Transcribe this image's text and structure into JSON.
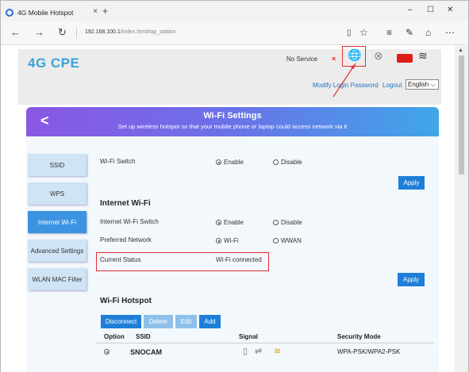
{
  "browser": {
    "tab_title": "4G Mobile Hotspot",
    "tab_close": "×",
    "new_tab": "+",
    "window_minimize": "–",
    "window_maximize": "☐",
    "window_close": "✕",
    "url_host": "192.168.100.1",
    "url_path": "/index.html#ap_station"
  },
  "header": {
    "logo": "4G CPE",
    "status_text": "No Service",
    "status_x": "×",
    "links": [
      "Modify Login Password",
      "Logout"
    ],
    "language": "English"
  },
  "banner": {
    "back": "<",
    "title": "Wi-Fi Settings",
    "subtitle": "Set up wireless hotspot so that your mobile phone or laptop could access network via it"
  },
  "sidebar": {
    "items": [
      {
        "label": "SSID",
        "active": false
      },
      {
        "label": "WPS",
        "active": false
      },
      {
        "label": "Internet Wi-Fi",
        "active": true
      },
      {
        "label": "Advanced Settings",
        "active": false
      },
      {
        "label": "WLAN MAC Filter",
        "active": false
      }
    ]
  },
  "wifi_switch": {
    "label": "Wi-Fi Switch",
    "options": [
      "Enable",
      "Disable"
    ],
    "selected": "Enable",
    "apply": "Apply"
  },
  "internet_wifi": {
    "heading": "Internet Wi-Fi",
    "switch_label": "Internet Wi-Fi Switch",
    "switch_options": [
      "Enable",
      "Disable"
    ],
    "switch_selected": "Enable",
    "preferred_label": "Preferred Network",
    "preferred_options": [
      "Wi-Fi",
      "WWAN"
    ],
    "preferred_selected": "Wi-Fi",
    "status_label": "Current Status",
    "status_value": "Wi-Fi connected",
    "apply": "Apply"
  },
  "hotspot": {
    "heading": "Wi-Fi Hotspot",
    "buttons": {
      "disconnect": "Disconnect",
      "delete": "Delete",
      "edit": "Edit",
      "add": "Add"
    },
    "columns": [
      "Option",
      "SSID",
      "Signal",
      "Security Mode"
    ],
    "rows": [
      {
        "ssid": "SNOCAM",
        "security": "WPA-PSK/WPA2-PSK",
        "selected": true
      }
    ]
  },
  "colors": {
    "accent": "#1e7fd8",
    "logo": "#3aa1d8",
    "highlight": "#e03030",
    "banner_start": "#8a57e4",
    "banner_end": "#3fa6e9"
  }
}
